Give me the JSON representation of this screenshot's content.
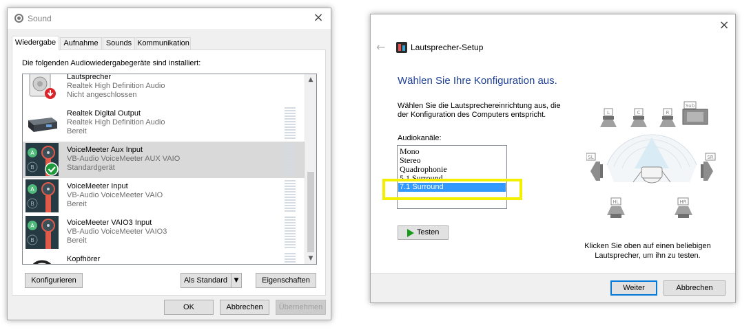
{
  "sound_dialog": {
    "title": "Sound",
    "tabs": [
      "Wiedergabe",
      "Aufnahme",
      "Sounds",
      "Kommunikation"
    ],
    "caption": "Die folgenden Audiowiedergabegeräte sind installiert:",
    "devices": [
      {
        "name": "Lautsprecher",
        "line1": "Realtek High Definition Audio",
        "line2": "Nicht angeschlossen",
        "icon": "speaker-disconnected-icon"
      },
      {
        "name": "Realtek Digital Output",
        "line1": "Realtek High Definition Audio",
        "line2": "Bereit",
        "icon": "digital-output-icon"
      },
      {
        "name": "VoiceMeeter Aux Input",
        "line1": "VB-Audio VoiceMeeter AUX VAIO",
        "line2": "Standardgerät",
        "icon": "voicemeeter-default-icon",
        "selected": true
      },
      {
        "name": "VoiceMeeter Input",
        "line1": "VB-Audio VoiceMeeter VAIO",
        "line2": "Bereit",
        "icon": "voicemeeter-icon"
      },
      {
        "name": "VoiceMeeter VAIO3 Input",
        "line1": "VB-Audio VoiceMeeter VAIO3",
        "line2": "Bereit",
        "icon": "voicemeeter-icon"
      },
      {
        "name": "Kopfhörer",
        "line1": "",
        "line2": "",
        "icon": "headphones-icon"
      }
    ],
    "buttons": {
      "configure": "Konfigurieren",
      "set_default": "Als Standard",
      "properties": "Eigenschaften",
      "ok": "OK",
      "cancel": "Abbrechen",
      "apply": "Übernehmen"
    }
  },
  "speaker_setup": {
    "title": "Lautsprecher-Setup",
    "heading": "Wählen Sie Ihre Konfiguration aus.",
    "description_line1": "Wählen Sie die Lautsprechereinrichtung aus, die",
    "description_line2": "der Konfiguration des Computers entspricht.",
    "channels_label": "Audiokanäle:",
    "channels": [
      "Mono",
      "Stereo",
      "Quadrophonie",
      "5.1 Surround",
      "7.1 Surround"
    ],
    "selected_channel": "7.1 Surround",
    "test_label": "Testen",
    "speaker_labels": {
      "L": "L",
      "C": "C",
      "R": "R",
      "Sub": "Sub",
      "SL": "SL",
      "SR": "SR",
      "HL": "HL",
      "HR": "HR"
    },
    "hint_line1": "Klicken Sie oben auf einen beliebigen",
    "hint_line2": "Lautsprecher, um ihn zu testen.",
    "next_label": "Weiter",
    "cancel_label": "Abbrechen"
  },
  "colors": {
    "accent": "#0078d7",
    "heading": "#1c3f95",
    "selection": "#3399ff",
    "highlight": "#f3ef00"
  }
}
